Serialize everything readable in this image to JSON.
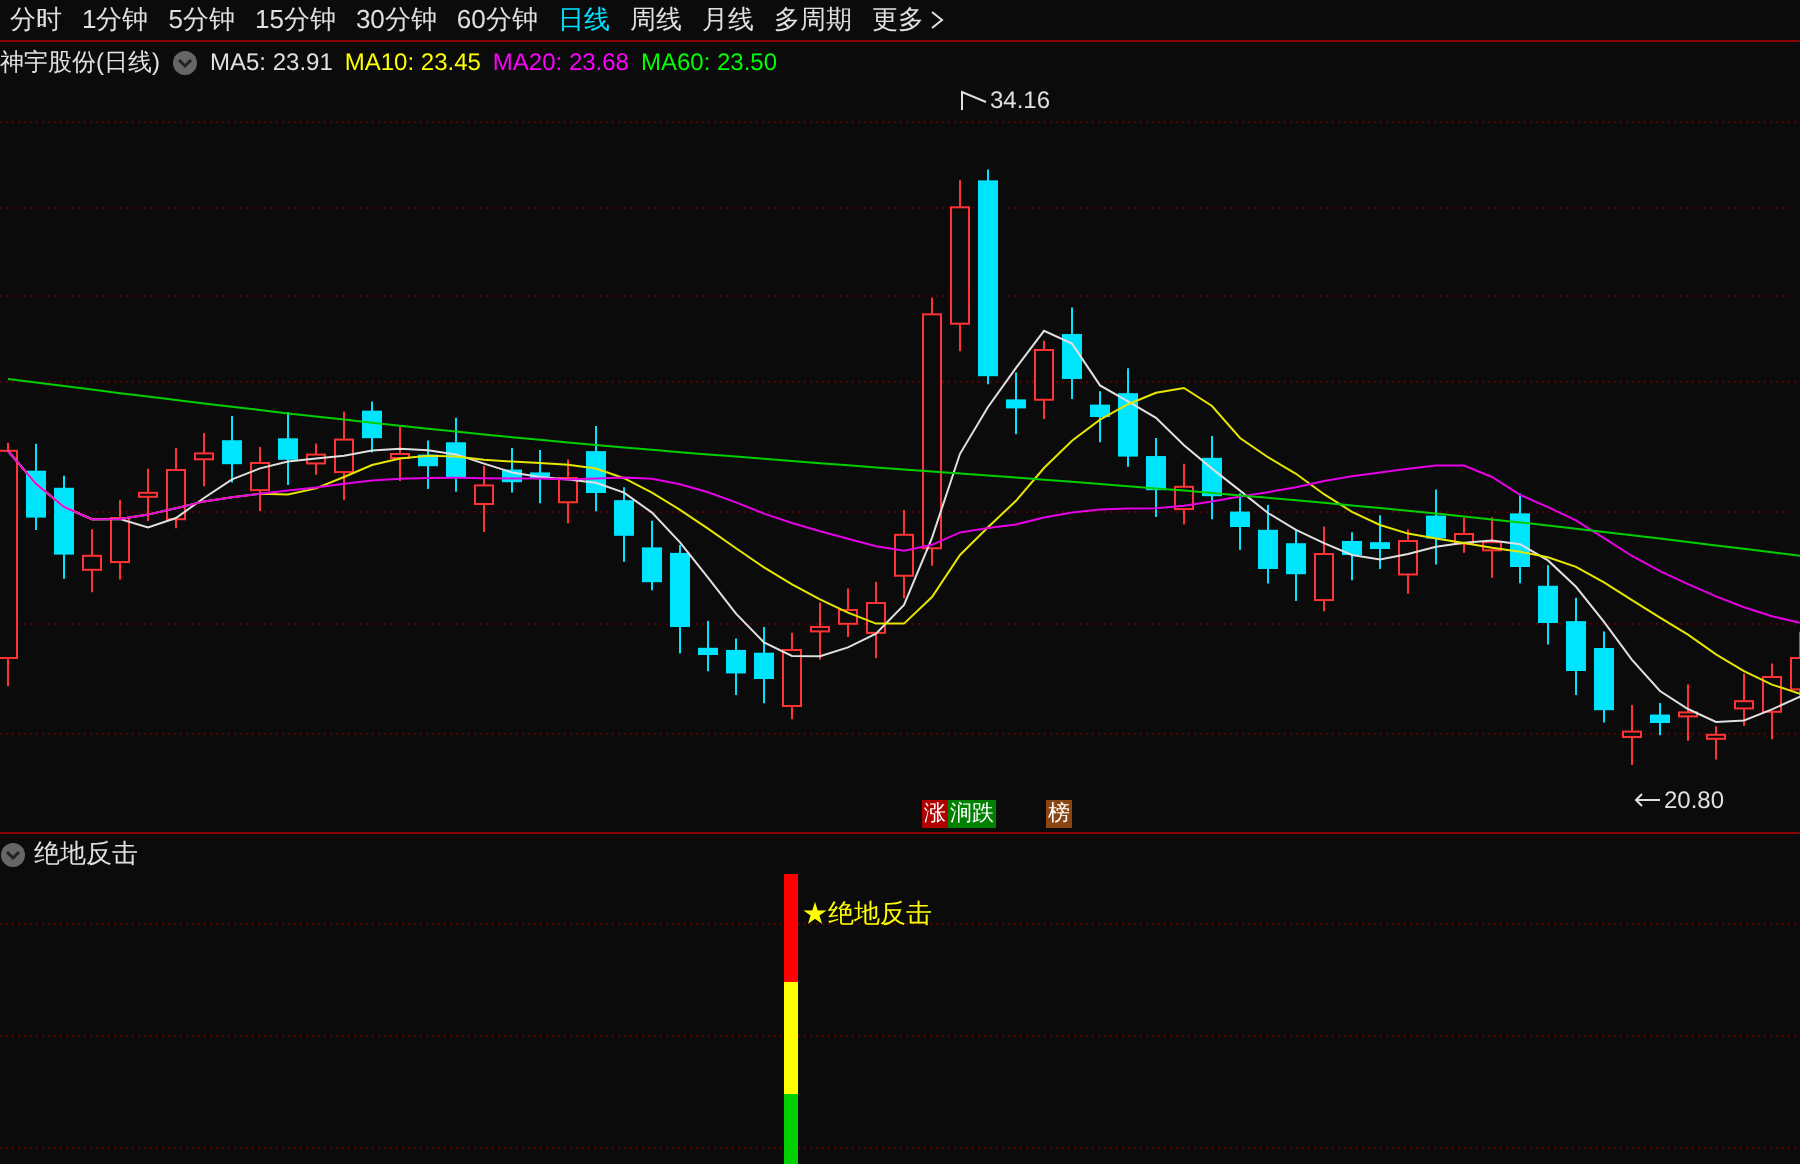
{
  "tabs": [
    {
      "label": "分时",
      "selected": false
    },
    {
      "label": "1分钟",
      "selected": false
    },
    {
      "label": "5分钟",
      "selected": false
    },
    {
      "label": "15分钟",
      "selected": false
    },
    {
      "label": "30分钟",
      "selected": false
    },
    {
      "label": "60分钟",
      "selected": false
    },
    {
      "label": "日线",
      "selected": true
    },
    {
      "label": "周线",
      "selected": false
    },
    {
      "label": "月线",
      "selected": false
    },
    {
      "label": "多周期",
      "selected": false
    },
    {
      "label": "更多",
      "selected": false
    }
  ],
  "chart_title": "神宇股份(日线)",
  "ma_labels": [
    {
      "label": "MA5: 23.91",
      "color": "#e0e0e0"
    },
    {
      "label": "MA10: 23.45",
      "color": "#ffff00"
    },
    {
      "label": "MA20: 23.68",
      "color": "#ff00ff"
    },
    {
      "label": "MA60: 23.50",
      "color": "#00ff00"
    }
  ],
  "high_label": "34.16",
  "low_label": "20.80",
  "badges": [
    {
      "label": "涨",
      "color": "#b00000"
    },
    {
      "label": "涧跌",
      "color": "#008000"
    },
    {
      "label": "榜",
      "color": "#8b4513"
    }
  ],
  "indicator": {
    "title": "绝地反击",
    "signal_label": "★绝地反击"
  }
}
